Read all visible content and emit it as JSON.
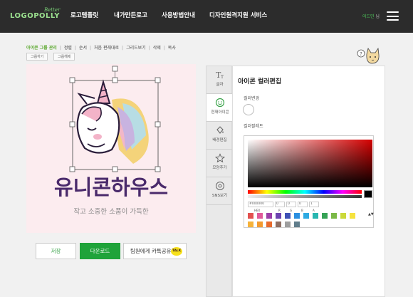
{
  "header": {
    "logo_script": "Better",
    "logo_text": "LOGOPOLLY",
    "nav": [
      "로고템플릿",
      "내가만든로고",
      "사용방법안내",
      "디자인원격지원 서비스"
    ],
    "user_name": "어드민",
    "user_suffix": "님"
  },
  "toolbar": {
    "items": [
      "아이콘 그룹 관리",
      "정렬",
      "순서",
      "처음 편래대로",
      "그리드보기",
      "삭제",
      "복사"
    ],
    "group_buttons": [
      "그룹하기",
      "그룹해제"
    ]
  },
  "canvas": {
    "title": "유니콘하우스",
    "subtitle": "작고 소중한 소품이 가득한",
    "colors": {
      "background": "#fcecef",
      "title": "#4a2a6b",
      "subtitle": "#888888"
    }
  },
  "actions": {
    "save": "저장",
    "download": "다운로드",
    "share": "팀원에게 카톡공유",
    "talk_badge": "TALK"
  },
  "sidetabs": [
    {
      "label": "글자",
      "icon": "text-icon"
    },
    {
      "label": "현재아이콘",
      "icon": "smile-icon"
    },
    {
      "label": "배경편집",
      "icon": "paint-bucket-icon"
    },
    {
      "label": "모양추가",
      "icon": "star-icon"
    },
    {
      "label": "SNS보기",
      "icon": "at-icon"
    }
  ],
  "panel": {
    "title": "아이콘 컬러편집",
    "color_change_label": "컬러변경",
    "palette_label": "컬러팔레트",
    "hex_value": "#000000",
    "r_value": "0",
    "g_value": "0",
    "b_value": "0",
    "a_value": "1",
    "field_labels": [
      "HEX",
      "R",
      "G",
      "B",
      "A"
    ]
  },
  "palette": {
    "row1": [
      "#e2514f",
      "#e05a9a",
      "#9b3fa9",
      "#6d43b0",
      "#3f51b5",
      "#2b8fe0",
      "#2eaae2",
      "#28b6b0",
      "#36a356",
      "#7bb947",
      "#cbd93a",
      "#f6e33f"
    ],
    "row2": [
      "#f6b23a",
      "#f39a2f",
      "#e86a2c",
      "#8d6e63",
      "#9e9e9e",
      "#607d8b"
    ]
  },
  "accent": "#1fa33a"
}
